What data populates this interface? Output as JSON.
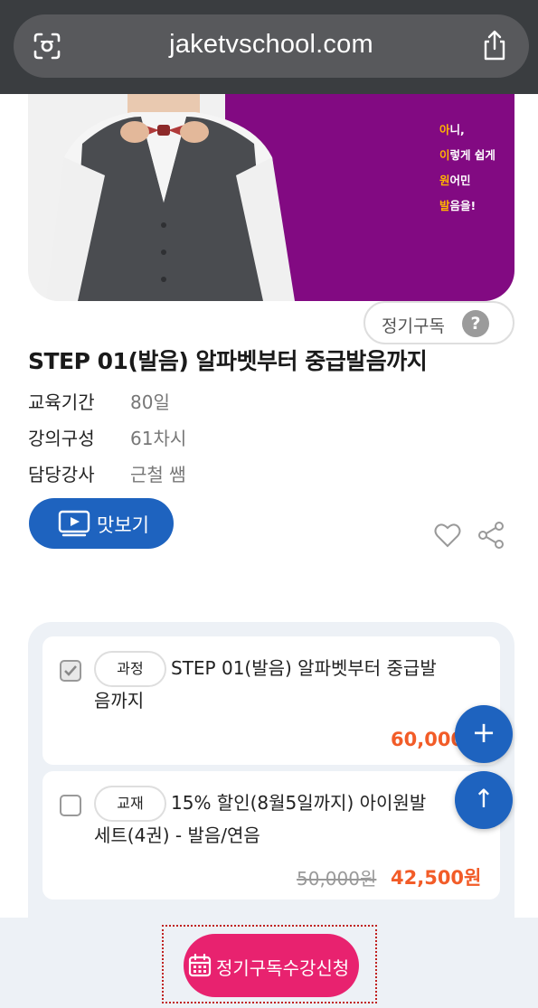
{
  "browser": {
    "url": "jaketvschool.com",
    "left_icon": "camera-scan-icon",
    "right_icon": "share-icon"
  },
  "hero": {
    "lines": [
      {
        "hl": "아",
        "rest": "니,"
      },
      {
        "hl": "이",
        "rest": "렇게 쉽게"
      },
      {
        "hl": "원",
        "rest": "어민"
      },
      {
        "hl": "발",
        "rest": "음을!"
      }
    ],
    "colors": {
      "purple": "#820a82",
      "highlight": "#ffb400"
    }
  },
  "subscription": {
    "label": "정기구독",
    "help_glyph": "?"
  },
  "course": {
    "title": "STEP 01(발음) 알파벳부터 중급발음까지",
    "info": [
      {
        "label": "교육기간",
        "value": "80일"
      },
      {
        "label": "강의구성",
        "value": "61차시"
      },
      {
        "label": "담당강사",
        "value": "근철 쌤"
      }
    ],
    "preview_label": "맛보기"
  },
  "products": [
    {
      "checked": true,
      "tag": "과정",
      "title": "STEP 01(발음) 알파벳부터 중급발음까지",
      "price": "60,000"
    },
    {
      "checked": false,
      "tag": "교재",
      "title": "15% 할인(8월5일까지) 아이원발 세트(4권) - 발음/연음",
      "original_price": "50,000원",
      "price": "42,500원"
    }
  ],
  "fabs": {
    "plus": "+",
    "up": "↑"
  },
  "bottom": {
    "apply_label": "정기구독수강신청"
  },
  "colors": {
    "primary_blue": "#1e63bf",
    "price_orange": "#f25c28",
    "cta_pink": "#e8226f"
  }
}
